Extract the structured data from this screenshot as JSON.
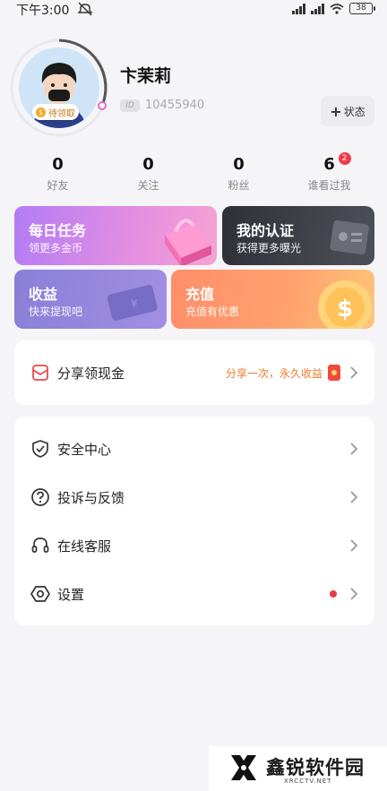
{
  "status_bar": {
    "time": "下午3:00",
    "battery": "38"
  },
  "profile": {
    "username": "卞茉莉",
    "uid_tag": "ID",
    "uid": "10455940",
    "claim_badge": "待领取",
    "status_button": "状态"
  },
  "stats": [
    {
      "value": "0",
      "label": "好友"
    },
    {
      "value": "0",
      "label": "关注"
    },
    {
      "value": "0",
      "label": "粉丝"
    },
    {
      "value": "6",
      "label": "谁看过我",
      "badge": "2"
    }
  ],
  "cards": {
    "daily": {
      "title": "每日任务",
      "subtitle": "领更多金币"
    },
    "cert": {
      "title": "我的认证",
      "subtitle": "获得更多曝光"
    },
    "income": {
      "title": "收益",
      "subtitle": "快来提现吧"
    },
    "recharge": {
      "title": "充值",
      "subtitle": "充值有优惠"
    }
  },
  "share": {
    "label": "分享领现金",
    "hint": "分享一次，永久收益"
  },
  "menu": [
    {
      "label": "安全中心",
      "icon": "shield-check-icon"
    },
    {
      "label": "投诉与反馈",
      "icon": "question-circle-icon"
    },
    {
      "label": "在线客服",
      "icon": "headset-icon"
    },
    {
      "label": "设置",
      "icon": "hexagon-gear-icon",
      "dot": true
    }
  ],
  "watermark": {
    "brand": "鑫锐软件园",
    "site": "XRCCTV.NET"
  },
  "colors": {
    "accent_orange": "#f07a2a",
    "red_dot": "#e8394a",
    "badge_red": "#f03a4b"
  }
}
